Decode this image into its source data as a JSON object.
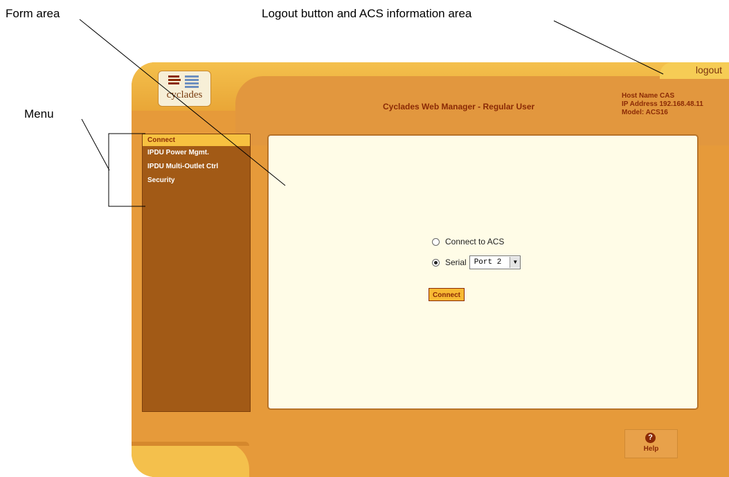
{
  "annotations": {
    "form_area": "Form area",
    "logout_area": "Logout button and ACS information area",
    "menu": "Menu"
  },
  "logo": {
    "text": "cyclades"
  },
  "header": {
    "title": "Cyclades Web Manager - Regular User",
    "logout": "logout",
    "host_name": "Host Name CAS",
    "ip_address": "IP Address 192.168.48.11",
    "model": "Model: ACS16"
  },
  "menu": {
    "items": [
      {
        "label": "Connect",
        "active": true
      },
      {
        "label": "IPDU Power Mgmt.",
        "active": false
      },
      {
        "label": "IPDU Multi-Outlet Ctrl",
        "active": false
      },
      {
        "label": "Security",
        "active": false
      }
    ]
  },
  "form": {
    "option_acs": "Connect to ACS",
    "option_serial": "Serial",
    "serial_selected": "Serial",
    "port_value": "Port 2",
    "connect_button": "Connect"
  },
  "help": {
    "label": "Help"
  },
  "colors": {
    "frame": "#e69a3a",
    "menu_bg": "#a25a16",
    "menu_active": "#f7c140",
    "form_bg": "#fffce7",
    "text_dark": "#8b2a05"
  }
}
